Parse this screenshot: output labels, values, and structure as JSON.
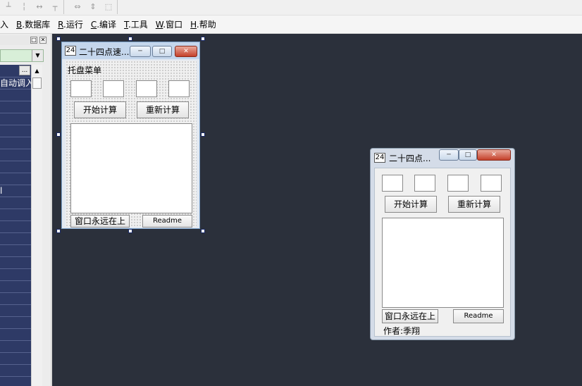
{
  "toolbar": {
    "icons": [
      "align-top-icon",
      "space-horizontal-icon",
      "space-equal-icon",
      "align-bottom-icon",
      "width-icon",
      "height-icon",
      "size-icon"
    ]
  },
  "menubar": {
    "items": [
      {
        "key": "",
        "label": "入"
      },
      {
        "key": "B",
        "label": ".数据库"
      },
      {
        "key": "R",
        "label": ".运行"
      },
      {
        "key": "C",
        "label": ".编译"
      },
      {
        "key": "T",
        "label": ".工具"
      },
      {
        "key": "W",
        "label": ".窗口"
      },
      {
        "key": "H",
        "label": ".帮助"
      }
    ]
  },
  "left_panel": {
    "ellipsis": "...",
    "rows": [
      "自动调入:",
      "",
      "",
      "",
      "",
      "",
      "",
      "",
      "",
      "l",
      "",
      "",
      "",
      "",
      "",
      "",
      "",
      "",
      "",
      "",
      "",
      "",
      "",
      "",
      "",
      ""
    ]
  },
  "design_window": {
    "icon_text": "24",
    "title": "二十四点速...",
    "menu_label": "托盘菜单",
    "start_button": "开始计算",
    "reset_button": "重新计算",
    "ontop_button": "窗口永远在上",
    "readme_button": "Readme"
  },
  "run_window": {
    "icon_text": "24",
    "title": "二十四点...",
    "start_button": "开始计算",
    "reset_button": "重新计算",
    "ontop_button": "窗口永远在上",
    "readme_button": "Readme",
    "author_label": "作者:季翔"
  }
}
